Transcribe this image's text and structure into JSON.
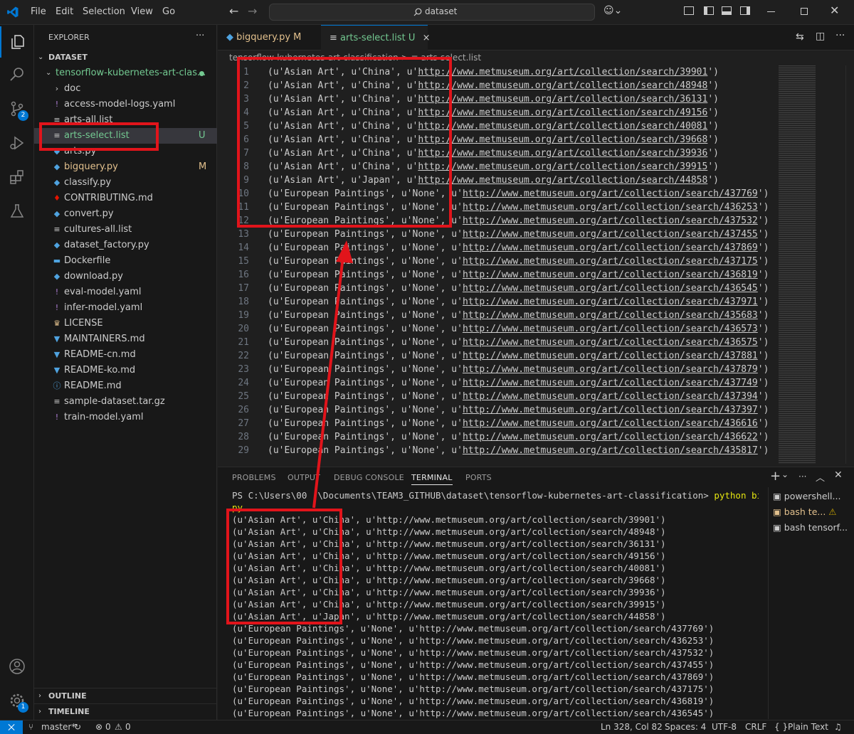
{
  "titlebar": {
    "menu": [
      "File",
      "Edit",
      "Selection",
      "View",
      "Go"
    ],
    "search_text": "dataset",
    "search_icon": "search-icon"
  },
  "explorer": {
    "header": "EXPLORER",
    "more": "···",
    "root": "DATASET",
    "folder": "tensorflow-kubernetes-art-clas...",
    "items": [
      {
        "label": "doc",
        "icon": "chevron-right-icon",
        "badge": "",
        "color": "#cccccc"
      },
      {
        "label": "access-model-logs.yaml",
        "icon": "exclamation-icon",
        "badge": "",
        "color": "#cccccc"
      },
      {
        "label": "arts-all.list",
        "icon": "list-icon",
        "badge": "",
        "color": "#cccccc"
      },
      {
        "label": "arts-select.list",
        "icon": "list-icon",
        "badge": "U",
        "color": "#73c991"
      },
      {
        "label": "arts.py",
        "icon": "python-icon",
        "badge": "",
        "color": "#cccccc"
      },
      {
        "label": "bigquery.py",
        "icon": "python-icon",
        "badge": "M",
        "color": "#e2c08d"
      },
      {
        "label": "classify.py",
        "icon": "python-icon",
        "badge": "",
        "color": "#cccccc"
      },
      {
        "label": "CONTRIBUTING.md",
        "icon": "ribbon-icon",
        "badge": "",
        "color": "#cccccc"
      },
      {
        "label": "convert.py",
        "icon": "python-icon",
        "badge": "",
        "color": "#cccccc"
      },
      {
        "label": "cultures-all.list",
        "icon": "list-icon",
        "badge": "",
        "color": "#cccccc"
      },
      {
        "label": "dataset_factory.py",
        "icon": "python-icon",
        "badge": "",
        "color": "#cccccc"
      },
      {
        "label": "Dockerfile",
        "icon": "docker-icon",
        "badge": "",
        "color": "#cccccc"
      },
      {
        "label": "download.py",
        "icon": "python-icon",
        "badge": "",
        "color": "#cccccc"
      },
      {
        "label": "eval-model.yaml",
        "icon": "exclamation-icon",
        "badge": "",
        "color": "#cccccc"
      },
      {
        "label": "infer-model.yaml",
        "icon": "exclamation-icon",
        "badge": "",
        "color": "#cccccc"
      },
      {
        "label": "LICENSE",
        "icon": "license-icon",
        "badge": "",
        "color": "#cccccc"
      },
      {
        "label": "MAINTAINERS.md",
        "icon": "markdown-icon",
        "badge": "",
        "color": "#cccccc"
      },
      {
        "label": "README-cn.md",
        "icon": "markdown-icon",
        "badge": "",
        "color": "#cccccc"
      },
      {
        "label": "README-ko.md",
        "icon": "markdown-icon",
        "badge": "",
        "color": "#cccccc"
      },
      {
        "label": "README.md",
        "icon": "info-icon",
        "badge": "",
        "color": "#cccccc"
      },
      {
        "label": "sample-dataset.tar.gz",
        "icon": "list-icon",
        "badge": "",
        "color": "#cccccc"
      },
      {
        "label": "train-model.yaml",
        "icon": "exclamation-icon",
        "badge": "",
        "color": "#cccccc"
      }
    ],
    "outline": "OUTLINE",
    "timeline": "TIMELINE"
  },
  "activity": {
    "scm_badge": "2",
    "settings_badge": "1"
  },
  "tabs": [
    {
      "label": "bigquery.py",
      "badge": "M"
    },
    {
      "label": "arts-select.list",
      "badge": "U",
      "close": "×"
    }
  ],
  "breadcrumb": {
    "folder": "tensorflow-kubernetes-art-classification",
    "sep": ">",
    "file": "arts-select.list"
  },
  "editor_lines": [
    {
      "n": "1",
      "pre": "(u'Asian Art', u'China', u'",
      "url": "http://www.metmuseum.org/art/collection/search/39901",
      "post": "')"
    },
    {
      "n": "2",
      "pre": "(u'Asian Art', u'China', u'",
      "url": "http://www.metmuseum.org/art/collection/search/48948",
      "post": "')"
    },
    {
      "n": "3",
      "pre": "(u'Asian Art', u'China', u'",
      "url": "http://www.metmuseum.org/art/collection/search/36131",
      "post": "')"
    },
    {
      "n": "4",
      "pre": "(u'Asian Art', u'China', u'",
      "url": "http://www.metmuseum.org/art/collection/search/49156",
      "post": "')"
    },
    {
      "n": "5",
      "pre": "(u'Asian Art', u'China', u'",
      "url": "http://www.metmuseum.org/art/collection/search/40081",
      "post": "')"
    },
    {
      "n": "6",
      "pre": "(u'Asian Art', u'China', u'",
      "url": "http://www.metmuseum.org/art/collection/search/39668",
      "post": "')"
    },
    {
      "n": "7",
      "pre": "(u'Asian Art', u'China', u'",
      "url": "http://www.metmuseum.org/art/collection/search/39936",
      "post": "')"
    },
    {
      "n": "8",
      "pre": "(u'Asian Art', u'China', u'",
      "url": "http://www.metmuseum.org/art/collection/search/39915",
      "post": "')"
    },
    {
      "n": "9",
      "pre": "(u'Asian Art', u'Japan', u'",
      "url": "http://www.metmuseum.org/art/collection/search/44858",
      "post": "')"
    },
    {
      "n": "10",
      "pre": "(u'European Paintings', u'None', u'",
      "url": "http://www.metmuseum.org/art/collection/search/437769",
      "post": "')"
    },
    {
      "n": "11",
      "pre": "(u'European Paintings', u'None', u'",
      "url": "http://www.metmuseum.org/art/collection/search/436253",
      "post": "')"
    },
    {
      "n": "12",
      "pre": "(u'European Paintings', u'None', u'",
      "url": "http://www.metmuseum.org/art/collection/search/437532",
      "post": "')"
    },
    {
      "n": "13",
      "pre": "(u'European Paintings', u'None', u'",
      "url": "http://www.metmuseum.org/art/collection/search/437455",
      "post": "')"
    },
    {
      "n": "14",
      "pre": "(u'European Paintings', u'None', u'",
      "url": "http://www.metmuseum.org/art/collection/search/437869",
      "post": "')"
    },
    {
      "n": "15",
      "pre": "(u'European Paintings', u'None', u'",
      "url": "http://www.metmuseum.org/art/collection/search/437175",
      "post": "')"
    },
    {
      "n": "16",
      "pre": "(u'European Paintings', u'None', u'",
      "url": "http://www.metmuseum.org/art/collection/search/436819",
      "post": "')"
    },
    {
      "n": "17",
      "pre": "(u'European Paintings', u'None', u'",
      "url": "http://www.metmuseum.org/art/collection/search/436545",
      "post": "')"
    },
    {
      "n": "18",
      "pre": "(u'European Paintings', u'None', u'",
      "url": "http://www.metmuseum.org/art/collection/search/437971",
      "post": "')"
    },
    {
      "n": "19",
      "pre": "(u'European Paintings', u'None', u'",
      "url": "http://www.metmuseum.org/art/collection/search/435683",
      "post": "')"
    },
    {
      "n": "20",
      "pre": "(u'European Paintings', u'None', u'",
      "url": "http://www.metmuseum.org/art/collection/search/436573",
      "post": "')"
    },
    {
      "n": "21",
      "pre": "(u'European Paintings', u'None', u'",
      "url": "http://www.metmuseum.org/art/collection/search/436575",
      "post": "')"
    },
    {
      "n": "22",
      "pre": "(u'European Paintings', u'None', u'",
      "url": "http://www.metmuseum.org/art/collection/search/437881",
      "post": "')"
    },
    {
      "n": "23",
      "pre": "(u'European Paintings', u'None', u'",
      "url": "http://www.metmuseum.org/art/collection/search/437879",
      "post": "')"
    },
    {
      "n": "24",
      "pre": "(u'European Paintings', u'None', u'",
      "url": "http://www.metmuseum.org/art/collection/search/437749",
      "post": "')"
    },
    {
      "n": "25",
      "pre": "(u'European Paintings', u'None', u'",
      "url": "http://www.metmuseum.org/art/collection/search/437394",
      "post": "')"
    },
    {
      "n": "26",
      "pre": "(u'European Paintings', u'None', u'",
      "url": "http://www.metmuseum.org/art/collection/search/437397",
      "post": "')"
    },
    {
      "n": "27",
      "pre": "(u'European Paintings', u'None', u'",
      "url": "http://www.metmuseum.org/art/collection/search/436616",
      "post": "')"
    },
    {
      "n": "28",
      "pre": "(u'European Paintings', u'None', u'",
      "url": "http://www.metmuseum.org/art/collection/search/436622",
      "post": "')"
    },
    {
      "n": "29",
      "pre": "(u'European Paintings', u'None', u'",
      "url": "http://www.metmuseum.org/art/collection/search/435817",
      "post": "')"
    }
  ],
  "panel": {
    "tabs": [
      "PROBLEMS",
      "OUTPUT",
      "DEBUG CONSOLE",
      "TERMINAL",
      "PORTS"
    ],
    "active_tab": "TERMINAL",
    "prompt": "PS C:\\Users\\00  \\Documents\\TEAM3_GITHUB\\dataset\\tensorflow-kubernetes-art-classification>",
    "command": "python bigquery.",
    "command_wrap": "py",
    "output": [
      "(u'Asian Art', u'China', u'http://www.metmuseum.org/art/collection/search/39901')",
      "(u'Asian Art', u'China', u'http://www.metmuseum.org/art/collection/search/48948')",
      "(u'Asian Art', u'China', u'http://www.metmuseum.org/art/collection/search/36131')",
      "(u'Asian Art', u'China', u'http://www.metmuseum.org/art/collection/search/49156')",
      "(u'Asian Art', u'China', u'http://www.metmuseum.org/art/collection/search/40081')",
      "(u'Asian Art', u'China', u'http://www.metmuseum.org/art/collection/search/39668')",
      "(u'Asian Art', u'China', u'http://www.metmuseum.org/art/collection/search/39936')",
      "(u'Asian Art', u'China', u'http://www.metmuseum.org/art/collection/search/39915')",
      "(u'Asian Art', u'Japan', u'http://www.metmuseum.org/art/collection/search/44858')",
      "(u'European Paintings', u'None', u'http://www.metmuseum.org/art/collection/search/437769')",
      "(u'European Paintings', u'None', u'http://www.metmuseum.org/art/collection/search/436253')",
      "(u'European Paintings', u'None', u'http://www.metmuseum.org/art/collection/search/437532')",
      "(u'European Paintings', u'None', u'http://www.metmuseum.org/art/collection/search/437455')",
      "(u'European Paintings', u'None', u'http://www.metmuseum.org/art/collection/search/437869')",
      "(u'European Paintings', u'None', u'http://www.metmuseum.org/art/collection/search/437175')",
      "(u'European Paintings', u'None', u'http://www.metmuseum.org/art/collection/search/436819')",
      "(u'European Paintings', u'None', u'http://www.metmuseum.org/art/collection/search/436545')"
    ],
    "terminals": [
      {
        "label": "powershell...",
        "icon": "terminal-icon"
      },
      {
        "label": "bash te...",
        "icon": "terminal-icon",
        "warn": "⚠"
      },
      {
        "label": "bash tensorf...",
        "icon": "terminal-icon"
      }
    ],
    "add": "+",
    "chevron": "⌄"
  },
  "status": {
    "remote": "⨉",
    "branch": "master*",
    "errors": "0",
    "warnings": "0",
    "position": "Ln 328, Col 82",
    "spaces": "Spaces: 4",
    "encoding": "UTF-8",
    "eol": "CRLF",
    "language": "Plain Text",
    "braces": "{ }"
  },
  "colors": {
    "accent": "#0078d4",
    "annotation": "#e1141b",
    "url": "#cccccc",
    "untracked": "#73c991",
    "modified": "#e2c08d"
  }
}
